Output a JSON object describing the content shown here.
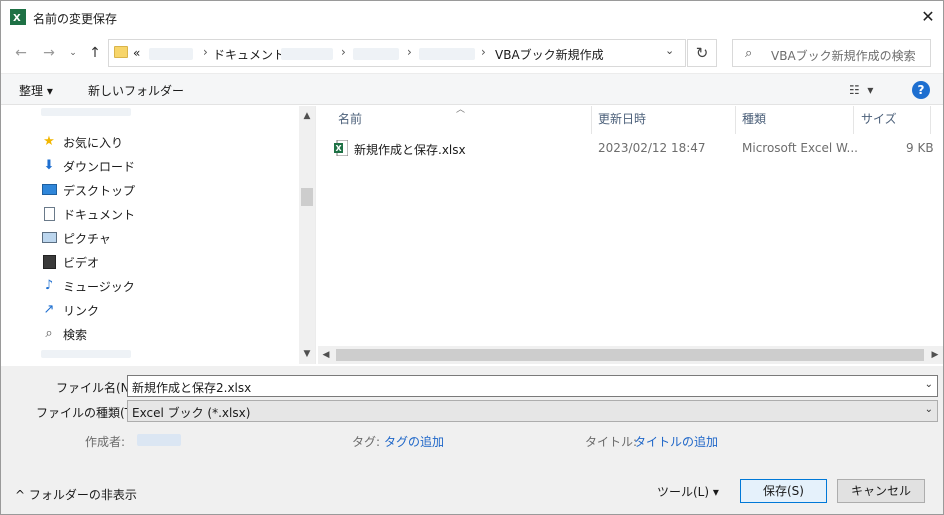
{
  "window": {
    "title": "名前の変更保存",
    "close_icon": "close-icon"
  },
  "nav": {
    "back_icon": "arrow-left-icon",
    "forward_icon": "arrow-right-icon",
    "dropdown_icon": "chevron-down-icon",
    "up_icon": "arrow-up-icon",
    "breadcrumb_prefix": "«",
    "breadcrumb": [
      "ドキュメント",
      "VBAブック新規作成"
    ],
    "refresh_icon": "refresh-icon",
    "search_placeholder": "VBAブック新規作成の検索"
  },
  "toolbar": {
    "organize_label": "整理 ▾",
    "new_folder_label": "新しいフォルダー",
    "view_icon": "view-options-icon",
    "help_label": "?"
  },
  "sidebar": {
    "items": [
      {
        "label": "お気に入り",
        "icon": "star-icon"
      },
      {
        "label": "ダウンロード",
        "icon": "download-icon"
      },
      {
        "label": "デスクトップ",
        "icon": "desktop-icon"
      },
      {
        "label": "ドキュメント",
        "icon": "document-icon"
      },
      {
        "label": "ピクチャ",
        "icon": "picture-icon"
      },
      {
        "label": "ビデオ",
        "icon": "video-icon"
      },
      {
        "label": "ミュージック",
        "icon": "music-icon"
      },
      {
        "label": "リンク",
        "icon": "link-icon"
      },
      {
        "label": "検索",
        "icon": "search-icon"
      }
    ]
  },
  "filelist": {
    "columns": [
      "名前",
      "更新日時",
      "種類",
      "サイズ"
    ],
    "rows": [
      {
        "name": "新規作成と保存.xlsx",
        "modified": "2023/02/12 18:47",
        "type": "Microsoft Excel W...",
        "size": "9 KB"
      }
    ]
  },
  "form": {
    "filename_label": "ファイル名(N):",
    "filename_value": "新規作成と保存2.xlsx",
    "filetype_label": "ファイルの種類(T):",
    "filetype_value": "Excel ブック (*.xlsx)",
    "author_label": "作成者:",
    "tags_label": "タグ:",
    "tags_link": "タグの追加",
    "title_label": "タイトル:",
    "title_link": "タイトルの追加"
  },
  "footer": {
    "hide_folders_label": "^  フォルダーの非表示",
    "tools_label": "ツール(L)   ▾",
    "save_label": "保存(S)",
    "cancel_label": "キャンセル"
  },
  "colors": {
    "accent": "#0078d7",
    "link": "#1e66c8",
    "excel_green": "#1e7145"
  }
}
